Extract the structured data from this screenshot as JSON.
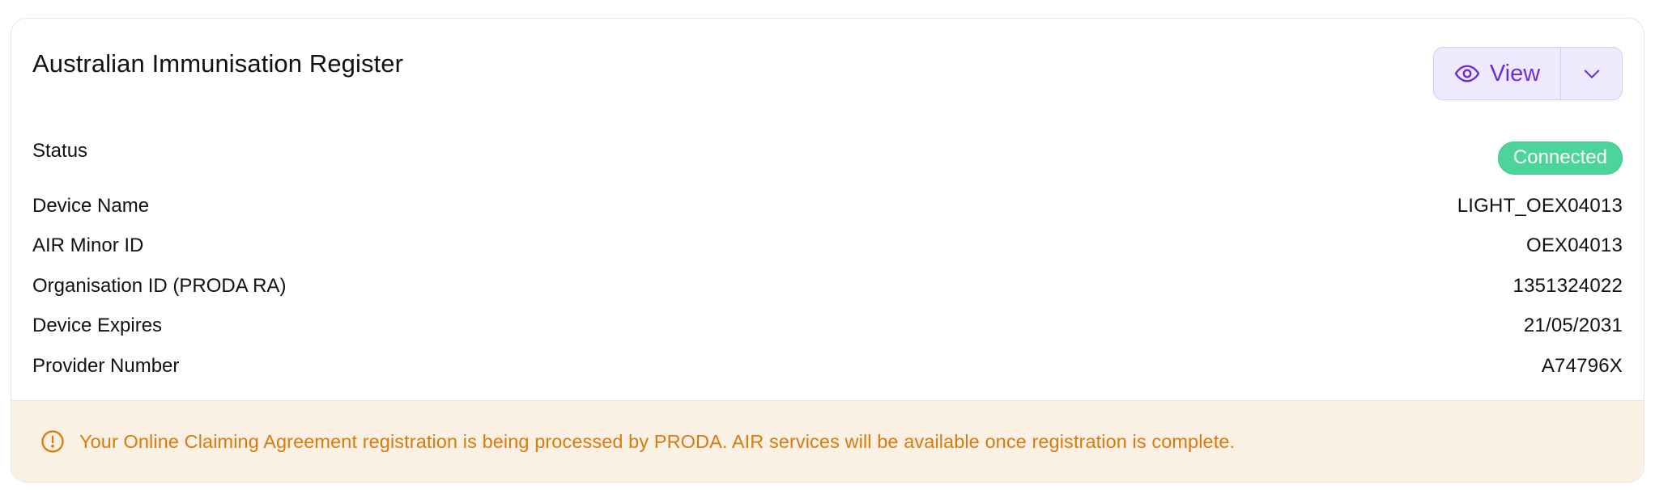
{
  "card": {
    "title": "Australian Immunisation Register",
    "view_button": {
      "label": "View",
      "icon": "eye-icon",
      "dropdown_icon": "chevron-down-icon"
    }
  },
  "fields": [
    {
      "label": "Status",
      "value": "Connected",
      "type": "badge"
    },
    {
      "label": "Device Name",
      "value": "LIGHT_OEX04013"
    },
    {
      "label": "AIR Minor ID",
      "value": "OEX04013"
    },
    {
      "label": "Organisation ID (PRODA RA)",
      "value": "1351324022"
    },
    {
      "label": "Device Expires",
      "value": "21/05/2031"
    },
    {
      "label": "Provider Number",
      "value": "A74796X"
    }
  ],
  "notice": {
    "icon": "alert-circle-icon",
    "text": "Your Online Claiming Agreement registration is being processed by PRODA. AIR services will be available once registration is complete."
  },
  "colors": {
    "accent": "#6a30d8",
    "accent_bg": "#efe9fd",
    "status_connected": "#4cd59a",
    "warning_text": "#d87a0c",
    "warning_bg": "#fbf0e4"
  }
}
